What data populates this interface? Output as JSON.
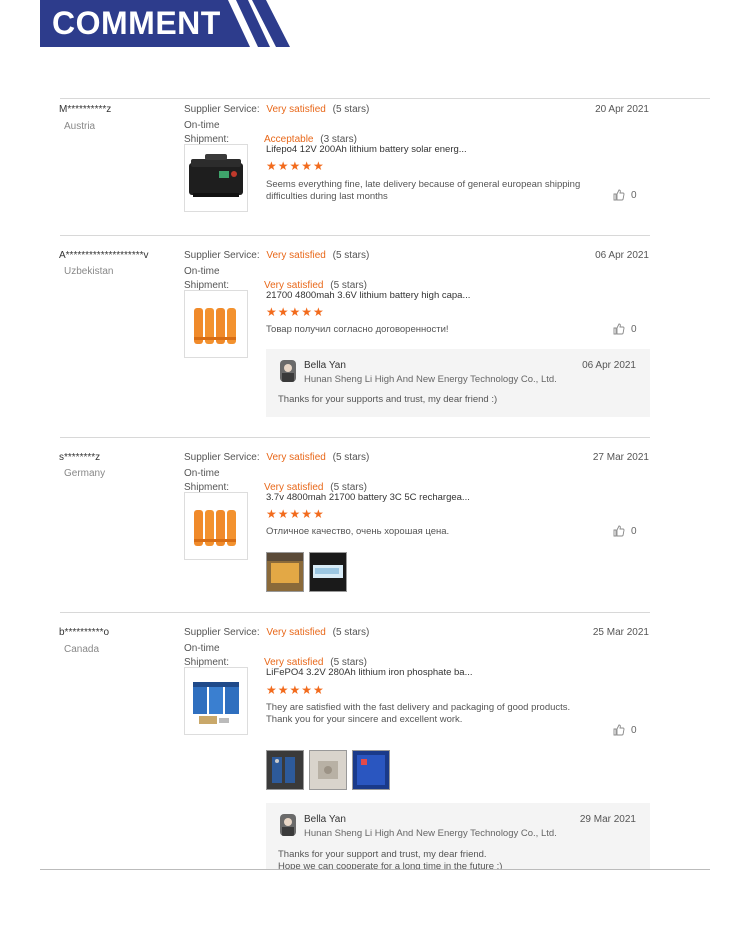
{
  "banner": {
    "title": "COMMENT",
    "color": "#2d3c8c"
  },
  "labels": {
    "supplier_service": "Supplier Service:",
    "ontime_line1": "On-time",
    "ontime_line2": "Shipment:"
  },
  "accent": "#e8681a",
  "reviews": [
    {
      "user": "M**********z",
      "country": "Austria",
      "date": "20 Apr 2021",
      "service_value": "Very satisfied",
      "service_stars": "(5 stars)",
      "shipment_value": "Acceptable",
      "shipment_stars": "(3 stars)",
      "product_title": "Lifepo4 12V 200Ah lithium battery solar energ...",
      "rating": "★★★★★",
      "comment": "Seems everything fine, late delivery  because of general european shipping difficulties  during last months",
      "likes": "0",
      "product_image": "black-battery-case"
    },
    {
      "user": "A********************v",
      "country": "Uzbekistan",
      "date": "06 Apr 2021",
      "service_value": "Very satisfied",
      "service_stars": "(5 stars)",
      "shipment_value": "Very satisfied",
      "shipment_stars": "(5 stars)",
      "product_title": "21700 4800mah 3.6V lithium battery high capa...",
      "rating": "★★★★★",
      "comment": "Товар получил согласно договоренности!",
      "likes": "0",
      "product_image": "orange-cells",
      "reply": {
        "name": "Bella Yan",
        "company": "Hunan Sheng Li High And New Energy Technology Co., Ltd.",
        "date": "06 Apr 2021",
        "text": "Thanks for your supports and trust, my dear friend :)"
      }
    },
    {
      "user": "s********z",
      "country": "Germany",
      "date": "27 Mar 2021",
      "service_value": "Very satisfied",
      "service_stars": "(5 stars)",
      "shipment_value": "Very satisfied",
      "shipment_stars": "(5 stars)",
      "product_title": "3.7v 4800mah 21700 battery 3C 5C rechargea...",
      "rating": "★★★★★",
      "comment": "Отличное качество, очень хорошая цена.",
      "likes": "0",
      "product_image": "orange-cells",
      "photos": [
        "photo-batteries",
        "photo-display"
      ]
    },
    {
      "user": "b**********o",
      "country": "Canada",
      "date": "25 Mar 2021",
      "service_value": "Very satisfied",
      "service_stars": "(5 stars)",
      "shipment_value": "Very satisfied",
      "shipment_stars": "(5 stars)",
      "product_title": "LiFePO4 3.2V 280Ah lithium iron phosphate ba...",
      "rating": "★★★★★",
      "comment": "They are satisfied with the fast delivery and packaging of good products.\nThank you for your sincere and excellent work.",
      "likes": "0",
      "product_image": "blue-cells",
      "photos": [
        "photo-cells-dark",
        "photo-cells-light",
        "photo-cells-blue"
      ],
      "reply": {
        "name": "Bella Yan",
        "company": "Hunan Sheng Li High And New Energy Technology Co., Ltd.",
        "date": "29 Mar 2021",
        "text": "Thanks for your support and trust, my dear friend.\nHope we can cooperate for a long time  in the future :)"
      }
    }
  ]
}
